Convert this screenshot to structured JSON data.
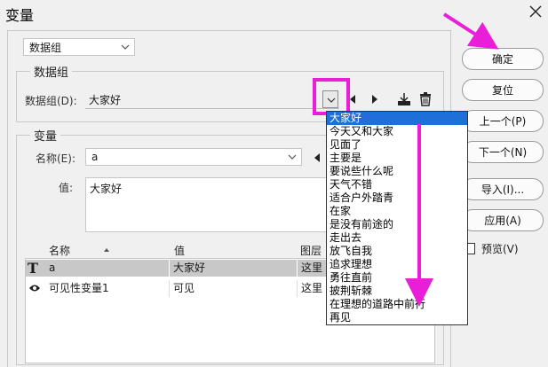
{
  "dialog": {
    "title": "变量"
  },
  "top_select": {
    "value": "数据组"
  },
  "dataset_group": {
    "title": "数据组",
    "label": "数据组(D):",
    "value": "大家好",
    "options": [
      "大家好",
      "今天又和大家",
      "见面了",
      "主要是",
      "要说些什么呢",
      "天气不错",
      "适合户外踏青",
      "在家",
      "是没有前途的",
      "走出去",
      "放飞自我",
      "追求理想",
      "勇往直前",
      "披荆斩棘",
      "在理想的道路中前行",
      "再见"
    ],
    "selected_index": 0
  },
  "variable_group": {
    "title": "变量",
    "name_label": "名称(E):",
    "name_value": "a",
    "value_label": "值:",
    "value_text": "大家好"
  },
  "table": {
    "columns": [
      "名称",
      "值",
      "图层"
    ],
    "rows": [
      {
        "icon": "text-icon",
        "name": "a",
        "value": "大家好",
        "layer": "这里"
      },
      {
        "icon": "eye-icon",
        "name": "可见性变量1",
        "value": "可见",
        "layer": "这里"
      }
    ]
  },
  "buttons": {
    "ok": "确定",
    "reset": "复位",
    "prev": "上一个(P)",
    "next": "下一个(N)",
    "import": "导入(I)...",
    "apply": "应用(A)"
  },
  "preview": {
    "label": "预览(V)",
    "checked": false
  },
  "annotation": {
    "color": "#e91ed9"
  }
}
